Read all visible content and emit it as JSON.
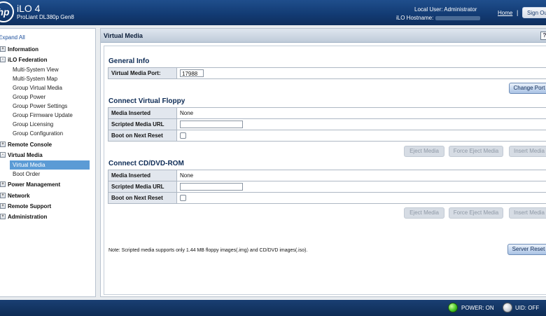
{
  "header": {
    "logo": "hp",
    "product": "iLO 4",
    "model": "ProLiant DL380p Gen8",
    "user_label": "Local User:",
    "user_value": "Administrator",
    "host_label": "iLO Hostname:",
    "home": "Home",
    "separator": "|",
    "sign_out": "Sign Out"
  },
  "sidebar": {
    "expand_all": "Expand All",
    "sections": [
      {
        "label": "Information",
        "toggle": "+"
      },
      {
        "label": "iLO Federation",
        "toggle": "-"
      },
      {
        "label": "Remote Console",
        "toggle": "+"
      },
      {
        "label": "Virtual Media",
        "toggle": "-"
      },
      {
        "label": "Power Management",
        "toggle": "+"
      },
      {
        "label": "Network",
        "toggle": "+"
      },
      {
        "label": "Remote Support",
        "toggle": "+"
      },
      {
        "label": "Administration",
        "toggle": "+"
      }
    ],
    "federation_items": [
      "Multi-System View",
      "Multi-System Map",
      "Group Virtual Media",
      "Group Power",
      "Group Power Settings",
      "Group Firmware Update",
      "Group Licensing",
      "Group Configuration"
    ],
    "virtual_media_items": [
      "Virtual Media",
      "Boot Order"
    ]
  },
  "page": {
    "title": "Virtual Media",
    "help": "?",
    "general_info": {
      "title": "General Info",
      "port_label": "Virtual Media Port:",
      "port_value": "17988",
      "change_port": "Change Port"
    },
    "floppy": {
      "title": "Connect Virtual Floppy",
      "media_inserted_label": "Media Inserted",
      "media_inserted_value": "None",
      "scripted_url_label": "Scripted Media URL",
      "scripted_url_value": "",
      "boot_next_label": "Boot on Next Reset",
      "eject": "Eject Media",
      "force_eject": "Force Eject Media",
      "insert": "Insert Media"
    },
    "cddvd": {
      "title": "Connect CD/DVD-ROM",
      "media_inserted_label": "Media Inserted",
      "media_inserted_value": "None",
      "scripted_url_label": "Scripted Media URL",
      "scripted_url_value": "",
      "boot_next_label": "Boot on Next Reset",
      "eject": "Eject Media",
      "force_eject": "Force Eject Media",
      "insert": "Insert Media"
    },
    "note": "Note: Scripted media supports only 1.44 MB floppy images(.img) and CD/DVD images(.iso).",
    "server_reset": "Server Reset"
  },
  "footer": {
    "power": "POWER: ON",
    "uid": "UID: OFF",
    "power_color": "#3fbf1f",
    "uid_color": "#c9ced6"
  }
}
